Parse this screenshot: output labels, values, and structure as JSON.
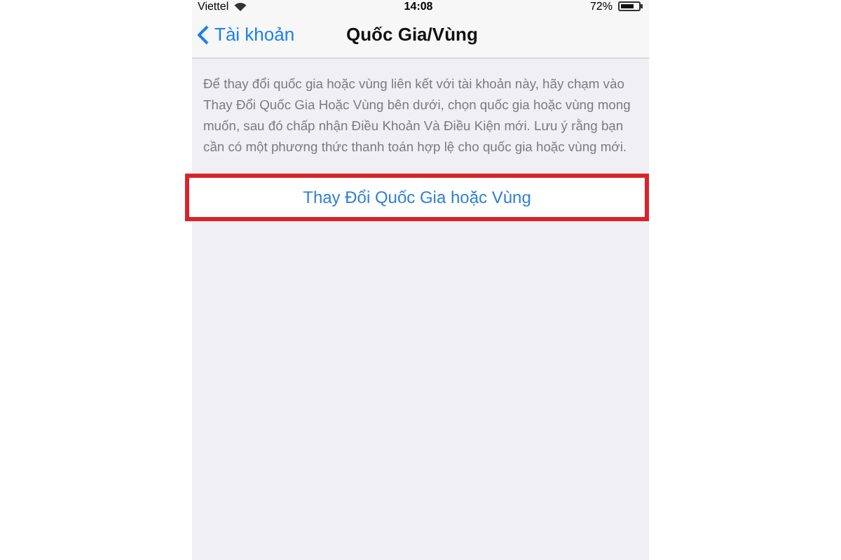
{
  "status_bar": {
    "carrier": "Viettel",
    "time": "14:08",
    "battery": "72%"
  },
  "nav_bar": {
    "back": "Tài khoản",
    "title": "Quốc Gia/Vùng"
  },
  "description": "Để thay đổi quốc gia hoặc vùng liên kết với tài khoản này, hãy chạm vào Thay Đổi Quốc Gia Hoặc Vùng bên dưới, chọn quốc gia hoặc vùng mong muốn, sau đó chấp nhận Điều Khoản Và Điều Kiện mới. Lưu ý rằng bạn cần có một phương thức thanh toán hợp lệ cho quốc gia hoặc vùng mới.",
  "action_button": {
    "label": "Thay Đổi Quốc Gia hoặc Vùng",
    "highlighted": true
  }
}
